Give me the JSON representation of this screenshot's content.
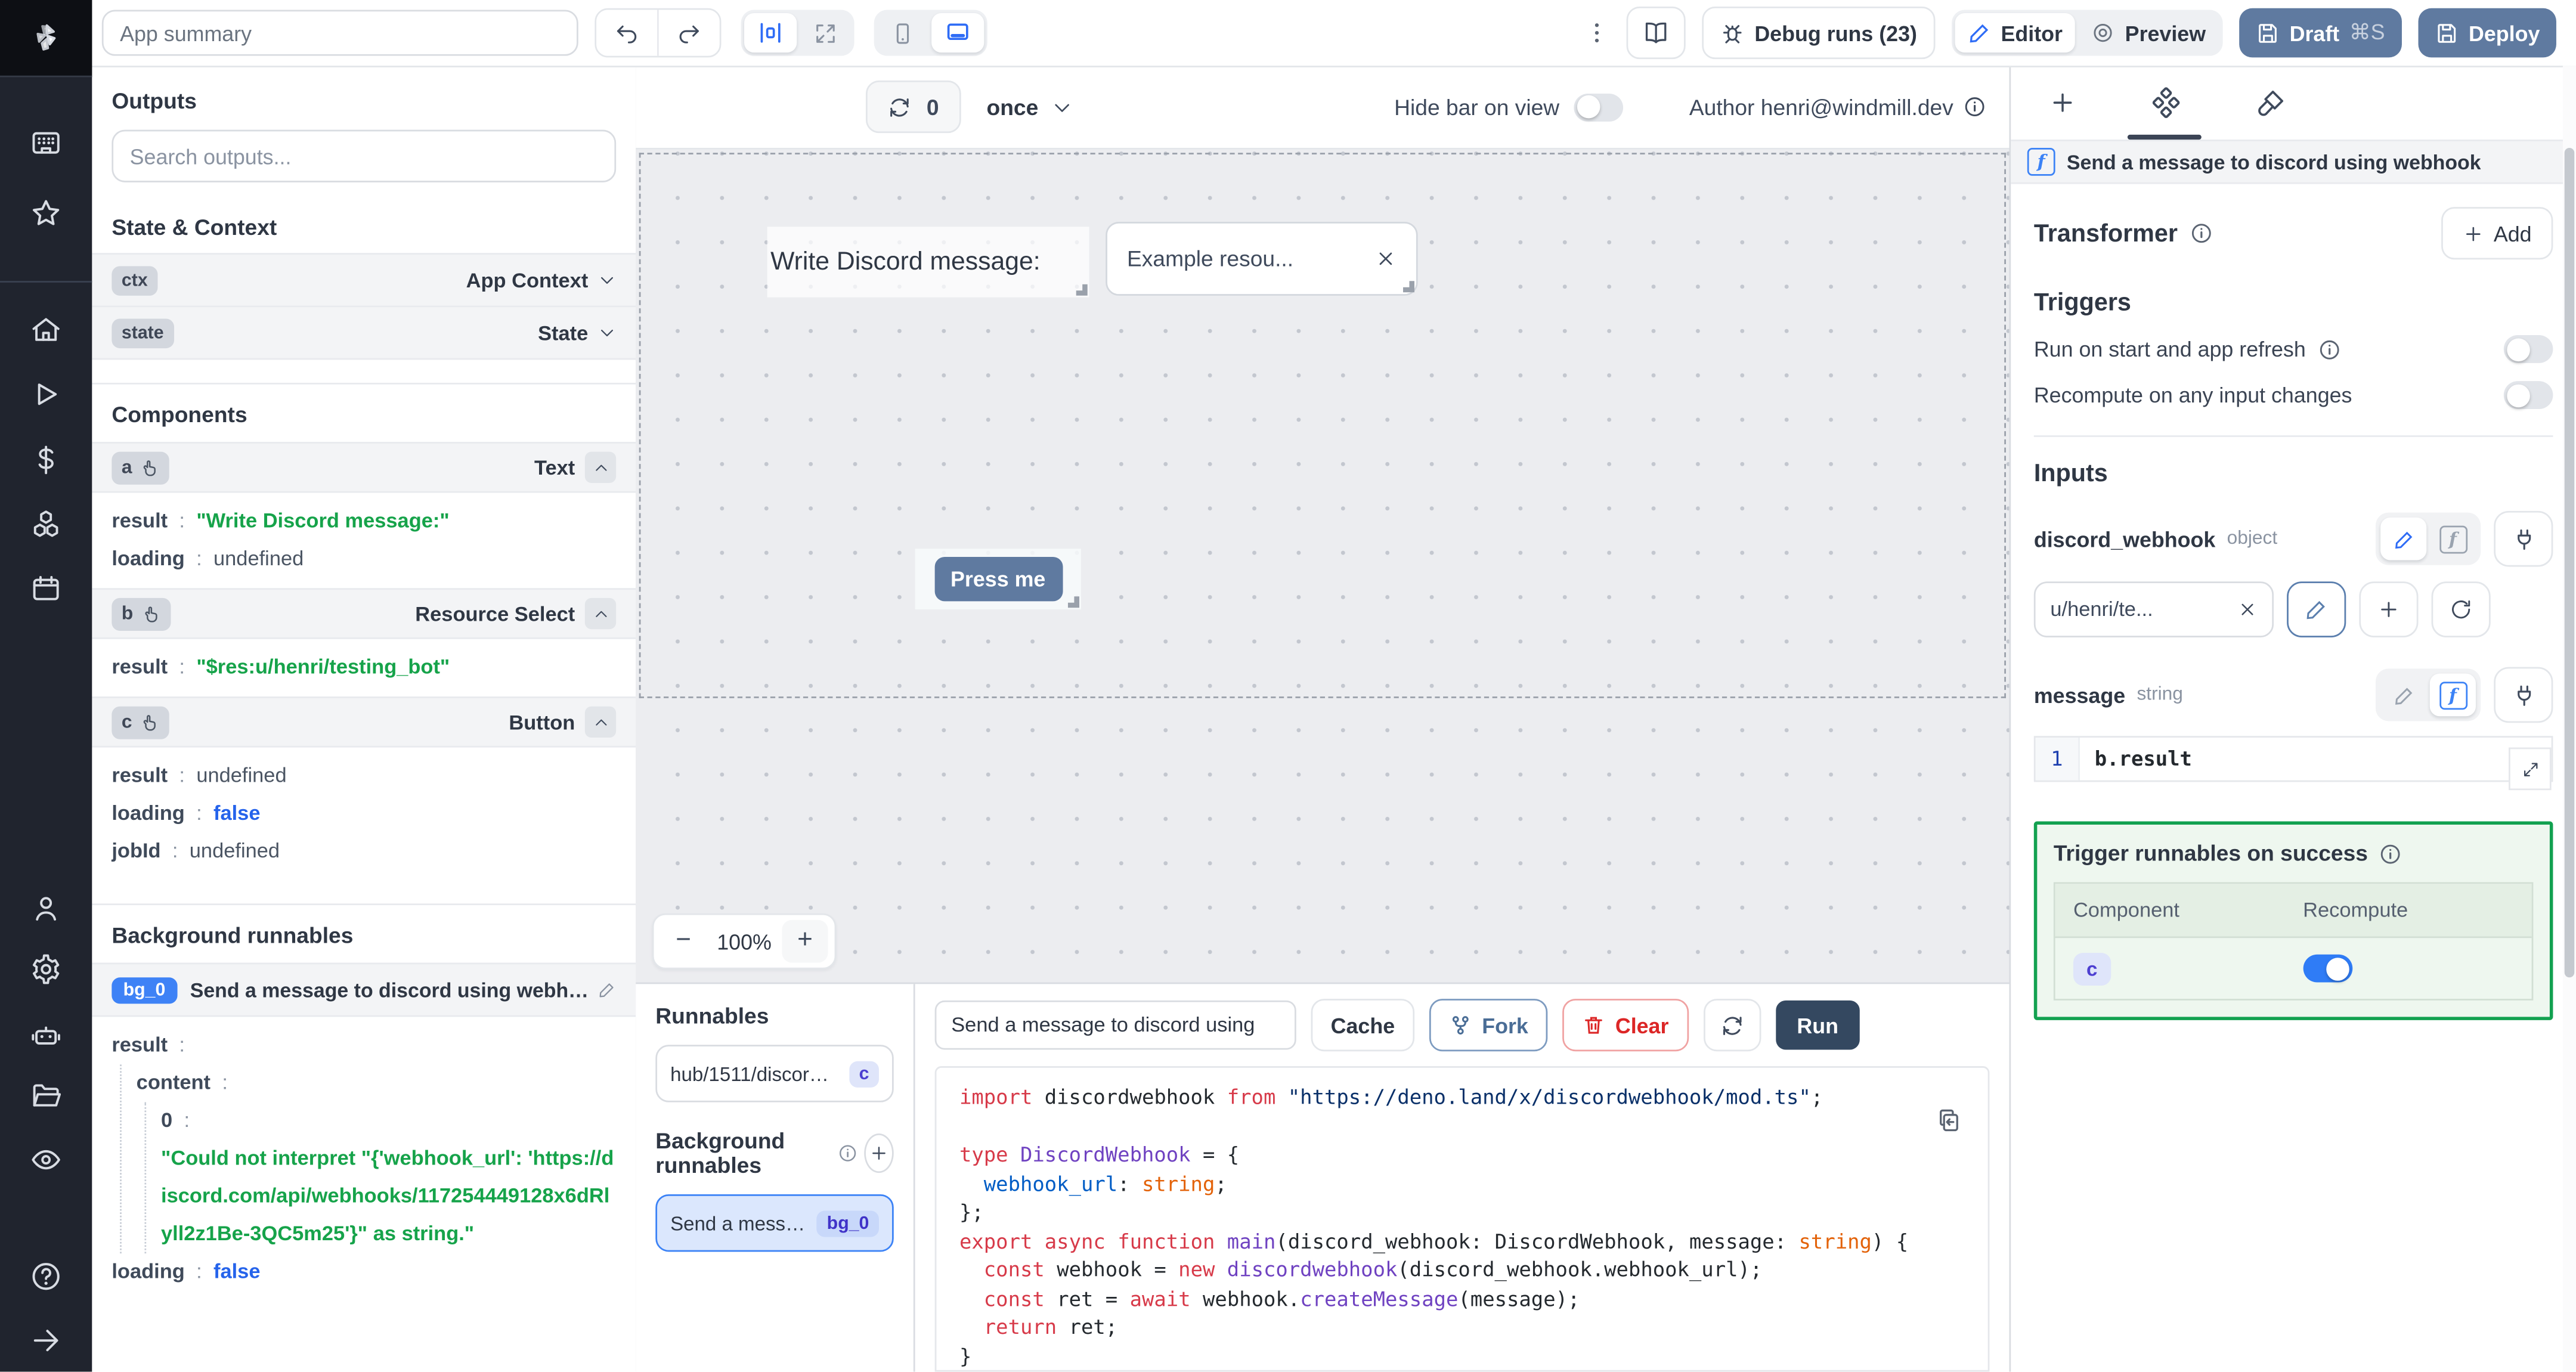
{
  "colors": {
    "accent": "#3b82f6",
    "slate_button": "#5f7aa0",
    "run_button": "#344860",
    "green": "#16a34a",
    "success_border": "#12a150",
    "keyword_red": "#d73a49"
  },
  "rail": {
    "icons": [
      "windmill-logo",
      "apps-icon",
      "star-icon",
      "home-icon",
      "play-icon",
      "dollar-icon",
      "cubes-icon",
      "calendar-icon",
      "user-icon",
      "gear-icon",
      "robot-icon",
      "folder-icon",
      "eye-icon",
      "help-icon",
      "arrow-right-icon"
    ]
  },
  "header": {
    "app_summary_placeholder": "App summary",
    "debug_runs_label": "Debug runs (23)",
    "editor_label": "Editor",
    "preview_label": "Preview",
    "draft_label": "Draft",
    "draft_shortcut": "⌘S",
    "deploy_label": "Deploy"
  },
  "canvas_toolbar": {
    "refresh_count": "0",
    "mode": "once",
    "hide_bar_label": "Hide bar on view",
    "author_label": "Author henri@windmill.dev"
  },
  "canvas": {
    "text_component": "Write Discord message:",
    "resource_select_value": "Example resou...",
    "button_label": "Press me",
    "zoom_level": "100%"
  },
  "outputs": {
    "title": "Outputs",
    "search_placeholder": "Search outputs...",
    "state_context_title": "State & Context",
    "context_rows": [
      {
        "id": "ctx",
        "type": "App Context"
      },
      {
        "id": "state",
        "type": "State"
      }
    ],
    "components_title": "Components",
    "components": [
      {
        "id": "a",
        "type": "Text",
        "props": [
          {
            "key": "result",
            "value": "\"Write Discord message:\""
          },
          {
            "key": "loading",
            "value": "undefined"
          }
        ]
      },
      {
        "id": "b",
        "type": "Resource Select",
        "props": [
          {
            "key": "result",
            "value": "\"$res:u/henri/testing_bot\""
          }
        ]
      },
      {
        "id": "c",
        "type": "Button",
        "props": [
          {
            "key": "result",
            "value": "undefined"
          },
          {
            "key": "loading",
            "value": "false"
          },
          {
            "key": "jobId",
            "value": "undefined"
          }
        ]
      }
    ],
    "background_title": "Background runnables",
    "bg_runnable": {
      "id": "bg_0",
      "name": "Send a message to discord using webhook",
      "result_key": "result",
      "content_key": "content",
      "index_key": "0",
      "error_string": "\"Could not interpret \"{'webhook_url': 'https://discord.com/api/webhooks/117254449128x6dRlyll2z1Be-3QC5m25'}\" as string.\"",
      "loading_key": "loading",
      "loading_value": "false"
    }
  },
  "runnables_panel": {
    "title": "Runnables",
    "item": {
      "path": "hub/1511/discord/se...",
      "badge": "c"
    },
    "background_title": "Background runnables",
    "bg_item": {
      "name": "Send a message...",
      "badge": "bg_0"
    }
  },
  "code_panel": {
    "name_value": "Send a message to discord using",
    "cache_label": "Cache",
    "fork_label": "Fork",
    "clear_label": "Clear",
    "run_label": "Run",
    "lines": [
      [
        {
          "t": "import",
          "c": "k"
        },
        {
          "t": " discordwebhook ",
          "c": "d"
        },
        {
          "t": "from",
          "c": "k"
        },
        {
          "t": " ",
          "c": "d"
        },
        {
          "t": "\"https://deno.land/x/discordwebhook/mod.ts\"",
          "c": "s"
        },
        {
          "t": ";",
          "c": "d"
        }
      ],
      [],
      [
        {
          "t": "type",
          "c": "k"
        },
        {
          "t": " ",
          "c": "d"
        },
        {
          "t": "DiscordWebhook",
          "c": "t"
        },
        {
          "t": " = {",
          "c": "d"
        }
      ],
      [
        {
          "t": "  ",
          "c": "d"
        },
        {
          "t": "webhook_url",
          "c": "p"
        },
        {
          "t": ": ",
          "c": "d"
        },
        {
          "t": "string",
          "c": "b"
        },
        {
          "t": ";",
          "c": "d"
        }
      ],
      [
        {
          "t": "};",
          "c": "d"
        }
      ],
      [
        {
          "t": "export",
          "c": "k"
        },
        {
          "t": " ",
          "c": "d"
        },
        {
          "t": "async",
          "c": "k"
        },
        {
          "t": " ",
          "c": "d"
        },
        {
          "t": "function",
          "c": "k"
        },
        {
          "t": " ",
          "c": "d"
        },
        {
          "t": "main",
          "c": "f"
        },
        {
          "t": "(discord_webhook: DiscordWebhook, message: ",
          "c": "d"
        },
        {
          "t": "string",
          "c": "b"
        },
        {
          "t": ") {",
          "c": "d"
        }
      ],
      [
        {
          "t": "  ",
          "c": "d"
        },
        {
          "t": "const",
          "c": "k"
        },
        {
          "t": " webhook = ",
          "c": "d"
        },
        {
          "t": "new",
          "c": "k"
        },
        {
          "t": " ",
          "c": "d"
        },
        {
          "t": "discordwebhook",
          "c": "f"
        },
        {
          "t": "(discord_webhook.webhook_url);",
          "c": "d"
        }
      ],
      [
        {
          "t": "  ",
          "c": "d"
        },
        {
          "t": "const",
          "c": "k"
        },
        {
          "t": " ret = ",
          "c": "d"
        },
        {
          "t": "await",
          "c": "k"
        },
        {
          "t": " webhook.",
          "c": "d"
        },
        {
          "t": "createMessage",
          "c": "f"
        },
        {
          "t": "(message);",
          "c": "d"
        }
      ],
      [
        {
          "t": "  ",
          "c": "d"
        },
        {
          "t": "return",
          "c": "k"
        },
        {
          "t": " ret;",
          "c": "d"
        }
      ],
      [
        {
          "t": "}",
          "c": "d"
        }
      ]
    ]
  },
  "right_panel": {
    "header": "Send a message to discord using webhook",
    "transformer_label": "Transformer",
    "add_label": "Add",
    "triggers_title": "Triggers",
    "trigger_run_on_start": "Run on start and app refresh",
    "trigger_recompute": "Recompute on any input changes",
    "inputs_title": "Inputs",
    "input_webhook": {
      "name": "discord_webhook",
      "type": "object",
      "value": "u/henri/te..."
    },
    "input_message": {
      "name": "message",
      "type": "string",
      "line_no": "1",
      "expr": "b.result"
    },
    "success_box": {
      "title": "Trigger runnables on success",
      "col_component": "Component",
      "col_recompute": "Recompute",
      "row_badge": "c"
    }
  }
}
